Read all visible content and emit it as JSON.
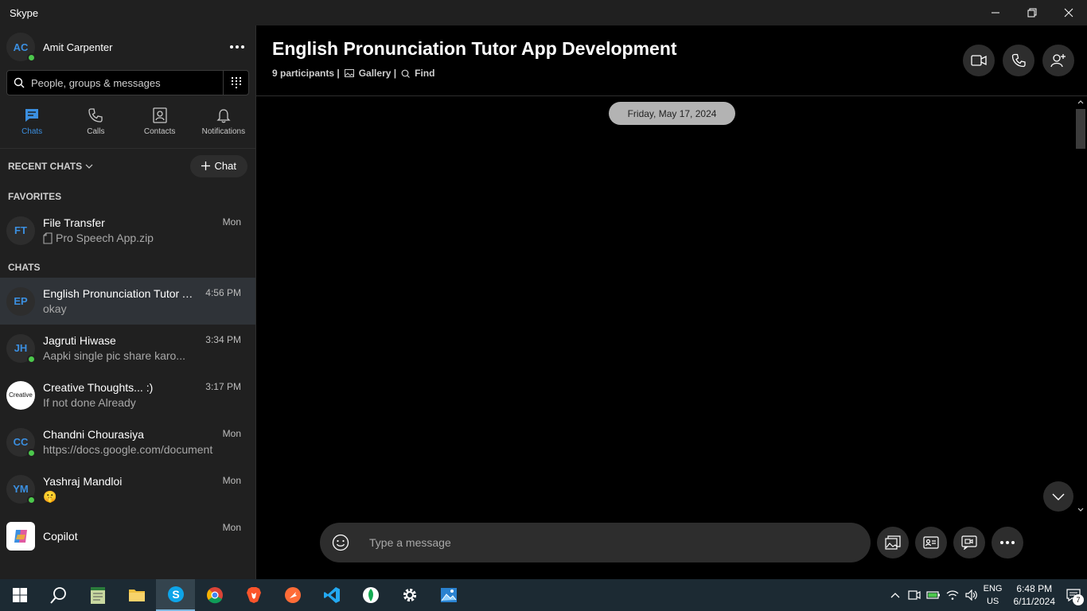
{
  "window": {
    "title": "Skype"
  },
  "profile": {
    "initials": "AC",
    "name": "Amit Carpenter"
  },
  "search": {
    "placeholder": "People, groups & messages"
  },
  "nav": [
    {
      "label": "Chats"
    },
    {
      "label": "Calls"
    },
    {
      "label": "Contacts"
    },
    {
      "label": "Notifications"
    }
  ],
  "recent": {
    "label": "RECENT CHATS",
    "new_chat_label": "Chat"
  },
  "favorites": {
    "label": "FAVORITES",
    "items": [
      {
        "initials": "FT",
        "name": "File Transfer",
        "preview": "Pro Speech App.zip",
        "time": "Mon"
      }
    ]
  },
  "chats": {
    "label": "CHATS",
    "items": [
      {
        "initials": "EP",
        "name": "English Pronunciation Tutor App Development",
        "preview": "okay",
        "time": "4:56 PM"
      },
      {
        "initials": "JH",
        "name": "Jagruti Hiwase",
        "preview": "Aapki single pic share karo...",
        "time": "3:34 PM"
      },
      {
        "initials": "Creative",
        "name": "Creative Thoughts... :)",
        "preview": "If not done Already",
        "time": "3:17 PM"
      },
      {
        "initials": "CC",
        "name": "Chandni Chourasiya",
        "preview": "https://docs.google.com/document",
        "time": "Mon"
      },
      {
        "initials": "YM",
        "name": "Yashraj Mandloi",
        "preview": "🤫",
        "time": "Mon"
      },
      {
        "initials": "",
        "name": "Copilot",
        "preview": "",
        "time": "Mon"
      }
    ]
  },
  "conversation": {
    "title": "English Pronunciation Tutor App Development",
    "participants": "9 participants |",
    "gallery": "Gallery |",
    "find": "Find",
    "date": "Friday, May 17, 2024"
  },
  "composer": {
    "placeholder": "Type a message"
  },
  "taskbar": {
    "lang_top": "ENG",
    "lang_bottom": "US",
    "time": "6:48 PM",
    "date": "6/11/2024",
    "notification_count": "7"
  },
  "colors": {
    "accent": "#3b8fe0",
    "online": "#4cc84c",
    "sidebar": "#202020"
  }
}
